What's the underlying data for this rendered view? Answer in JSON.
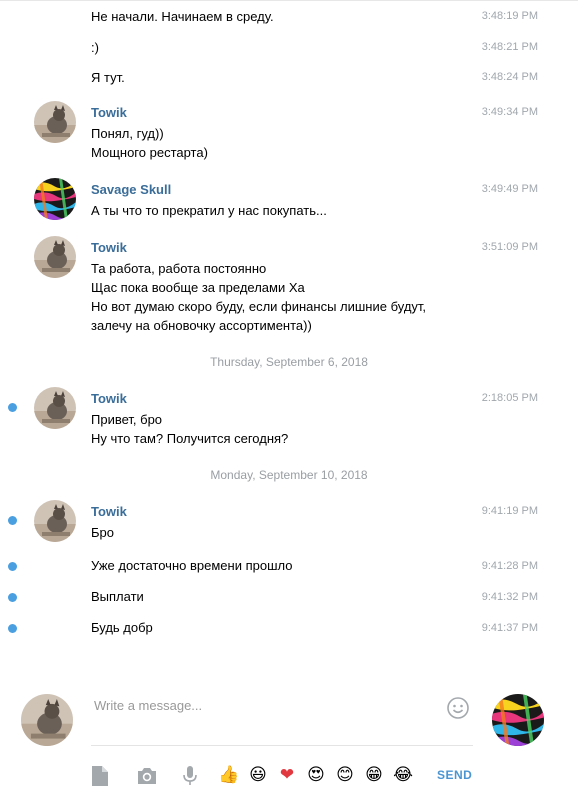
{
  "messages": [
    {
      "text": "Не начали. Начинаем в среду.",
      "time": "3:48:19 PM"
    },
    {
      "text": ":)",
      "time": "3:48:21 PM"
    },
    {
      "text": "Я тут.",
      "time": "3:48:24 PM"
    },
    {
      "author": "Towik",
      "lines": [
        "Понял, гуд))",
        "Мощного рестарта)"
      ],
      "time": "3:49:34 PM"
    },
    {
      "author": "Savage Skull",
      "lines": [
        "А ты что то прекратил у нас покупать..."
      ],
      "time": "3:49:49 PM"
    },
    {
      "author": "Towik",
      "lines": [
        "Та работа, работа постоянно",
        "Щас пока вообще за пределами Ха",
        "Но вот думаю скоро буду, если финансы лишние будут,",
        "залечу на обновочку ассортимента))"
      ],
      "time": "3:51:09 PM"
    },
    {
      "date": "Thursday, September 6, 2018"
    },
    {
      "author": "Towik",
      "lines": [
        "Привет, бро",
        "Ну что там? Получится сегодня?"
      ],
      "time": "2:18:05 PM",
      "unread": true
    },
    {
      "date": "Monday, September 10, 2018"
    },
    {
      "author": "Towik",
      "lines": [
        "Бро"
      ],
      "time": "9:41:19 PM",
      "unread": true
    },
    {
      "text": "Уже достаточно времени прошло",
      "time": "9:41:28 PM",
      "unread": true
    },
    {
      "text": "Выплати",
      "time": "9:41:32 PM",
      "unread": true
    },
    {
      "text": "Будь добр",
      "time": "9:41:37 PM",
      "unread": true
    }
  ],
  "compose": {
    "placeholder": "Write a message...",
    "send_label": "SEND",
    "toolbar_icons": [
      "attach-file-icon",
      "camera-icon",
      "microphone-icon"
    ],
    "emojis": [
      "👍",
      "😃",
      "❤",
      "😍",
      "😊",
      "😁",
      "😂"
    ]
  },
  "colors": {
    "author": "#3a6d99",
    "unread_dot": "#4a9fe1",
    "send": "#4a95d2",
    "time": "#a0a7ad"
  }
}
